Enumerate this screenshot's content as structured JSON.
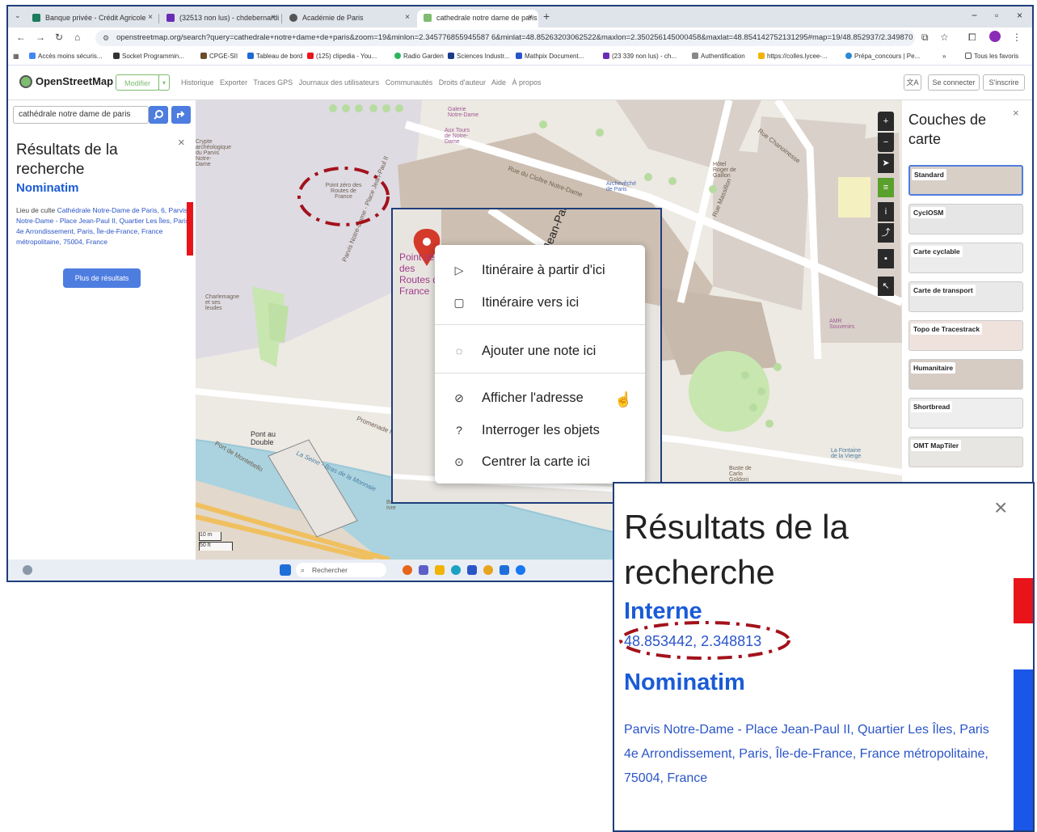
{
  "browser": {
    "tabs": [
      {
        "label": "Banque privée - Crédit Agricole",
        "active": false,
        "color": "#1c7c5c"
      },
      {
        "label": "(32513 non lus) - chdebernardi",
        "active": false,
        "color": "#6a2bb5"
      },
      {
        "label": "Académie de Paris",
        "active": false,
        "color": "#555555"
      },
      {
        "label": "cathedrale notre dame de paris",
        "active": true,
        "color": "#7ebc6f"
      }
    ],
    "new_tab": "+",
    "url": "openstreetmap.org/search?query=cathedrale+notre+dame+de+paris&zoom=19&minlon=2.345776855945587 6&minlat=48.85263203062522&maxlon=2.350256145000458&maxlat=48.854142752131295#map=19/48.852937/2.349870",
    "bookmarks": [
      "Accès moins sécuris...",
      "Socket Programmin...",
      "CPGE-SII",
      "Tableau de bord",
      "(125) clipedia - You...",
      "Radio Garden",
      "Sciences Industr...",
      "Mathpix Document...",
      "(23 339 non lus) - ch...",
      "Authentification",
      "https://colles.lycee-...",
      "Prépa_concours | Pe...",
      "»",
      "Tous les favoris"
    ]
  },
  "osm": {
    "logo": "OpenStreetMap",
    "edit": "Modifier",
    "nav": [
      "Historique",
      "Exporter",
      "Traces GPS",
      "Journaux des utilisateurs",
      "Communautés",
      "Droits d'auteur",
      "Aide",
      "À propos"
    ],
    "login": "Se connecter",
    "signup": "S'inscrire",
    "lang_icon": "translate-icon"
  },
  "sidebar": {
    "search_value": "cathédrale notre dame de paris",
    "title": "Résultats de la recherche",
    "close": "×",
    "provider": "Nominatim",
    "result_prefix": "Lieu de culte ",
    "result_link": "Cathédrale Notre-Dame de Paris, 6, Parvis Notre-Dame - Place Jean-Paul II, Quartier Les Îles, Paris 4e Arrondissement, Paris, Île-de-France, France métropolitaine, 75004, France",
    "more": "Plus de résultats"
  },
  "map": {
    "labels": {
      "point_zero": "Point zéro des Routes de France",
      "crypte": "Crypte archéologique du Parvis Notre-Dame",
      "galerie": "Galerie Notre-Dame",
      "tours": "Aux Tours de Notre-Dame",
      "rue_cloitre": "Rue du Cloître Notre-Dame",
      "rue_chanoinesse": "Rue Chanoinesse",
      "rue_massillon": "Rue Massillon",
      "hotel": "Hôtel Roger de Gaillon",
      "archeveche": "Archevêché de Paris",
      "parvis": "Parvis Notre-Dame - Place Jean-Paul II",
      "charlemagne": "Charlemagne et ses leudes",
      "pont": "Pont au Double",
      "seine": "La Seine - Bras de la Monnaie",
      "promenade": "Promenade Maurice Carême",
      "bateau": "Bateau Ivre",
      "montebello": "Port de Montebello",
      "fontaine": "La Fontaine de la Vierge",
      "buste": "Buste de Carlo Goldoni",
      "amr": "AMR Souvenirs",
      "scale_m": "10 m",
      "scale_ft": "50 ft",
      "inset_marker": "Point zéro des Routes de France",
      "inset_street": "Place Jean-Paul II"
    }
  },
  "context_menu": {
    "items": [
      {
        "icon": "▷",
        "label": "Itinéraire à partir d'ici"
      },
      {
        "icon": "▢",
        "label": "Itinéraire vers ici"
      },
      {
        "icon": "💬",
        "label": "Ajouter une note ici"
      },
      {
        "icon": "⊘",
        "label": "Afficher l'adresse"
      },
      {
        "icon": "?",
        "label": "Interroger les objets"
      },
      {
        "icon": "⊙",
        "label": "Centrer la carte ici"
      }
    ]
  },
  "layers": {
    "title": "Couches de carte",
    "close": "×",
    "items": [
      "Standard",
      "CyclOSM",
      "Carte cyclable",
      "Carte de transport",
      "Topo de Tracestrack",
      "Humanitaire",
      "Shortbread",
      "OMT MapTiler"
    ]
  },
  "taskbar": {
    "search": "Rechercher"
  },
  "zoom_inset": {
    "title": "Résultats de la recherche",
    "close": "×",
    "internal": "Interne",
    "coords": "48.853442, 2.348813",
    "provider": "Nominatim",
    "address": "Parvis Notre-Dame - Place Jean-Paul II, Quartier Les Îles, Paris 4e Arrondissement, Paris, Île-de-France, France métropolitaine, 75004, France"
  },
  "colors": {
    "accent_blue": "#1a5bd6",
    "button_blue": "#4e7de0",
    "osm_green": "#7ebc6f",
    "annotation_red": "#a3121b"
  }
}
